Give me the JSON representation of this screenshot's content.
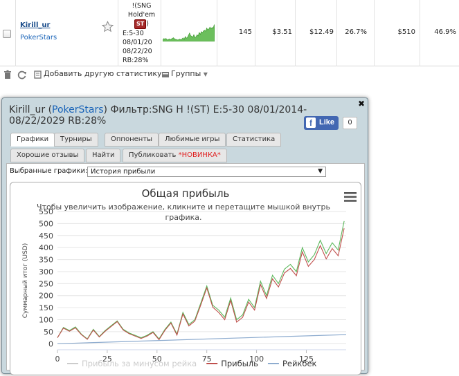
{
  "row": {
    "player": "Kirill_ur",
    "site": "PokerStars",
    "filter_lines": [
      "!(SNG",
      "Hold'em"
    ],
    "filter_badge": "ST",
    "filter_after_badge": ")",
    "filter_rest": [
      "E:5-30",
      "08/01/20",
      "08/22/20",
      "RB:28%"
    ],
    "games": "145",
    "avg_stake": "$3.51",
    "avg_profit": "$12.49",
    "avg_roi": "26.7%",
    "total_profit": "$510",
    "abi": "46.9%"
  },
  "toolbar": {
    "add_stats": "Добавить другую статистику",
    "groups": "Группы"
  },
  "popup": {
    "title_name": "Kirill_ur (",
    "title_site": "PokerStars",
    "title_rest": ") Фильтр:SNG H !(ST) E:5-30 08/01/2014-08/22/2029 RB:28%",
    "fb_like": "Like",
    "fb_count": "0",
    "tabs_row1": [
      "Графики",
      "Турниры",
      "Оппоненты",
      "Любимые игры",
      "Статистика"
    ],
    "tabs_row2": [
      "Хорошие отзывы",
      "Найти",
      "Публиковать "
    ],
    "tab_new": "*НОВИНКА*",
    "selector_label": "Выбранные графики:",
    "selector_value": "История прибыли"
  },
  "chart_data": {
    "type": "line",
    "title": "Общая прибыль",
    "subtitle": "Чтобы увеличить изображение, кликните и перетащите мышкой внутрь графика.",
    "ylabel": "Суммарный итог (USD)",
    "xlabel": "",
    "ylim": [
      -25,
      550
    ],
    "yticks": [
      0,
      50,
      100,
      150,
      200,
      250,
      300,
      350,
      400,
      450,
      500,
      550
    ],
    "xlim": [
      0,
      145
    ],
    "xticks": [
      0,
      25,
      50,
      75,
      100,
      125
    ],
    "colors": {
      "green": "#5cb85c",
      "red": "#c0504d",
      "blue": "#8eaccf"
    },
    "series": [
      {
        "name": "",
        "color": "#5cb85c",
        "x": [
          0,
          3,
          6,
          9,
          12,
          15,
          18,
          21,
          24,
          27,
          30,
          33,
          36,
          39,
          42,
          45,
          48,
          51,
          54,
          57,
          60,
          63,
          66,
          69,
          72,
          75,
          78,
          81,
          84,
          87,
          90,
          93,
          96,
          99,
          102,
          105,
          108,
          111,
          114,
          117,
          120,
          123,
          126,
          129,
          132,
          135,
          138,
          141,
          144
        ],
        "y": [
          25,
          68,
          55,
          70,
          40,
          20,
          60,
          30,
          55,
          75,
          95,
          60,
          45,
          35,
          25,
          35,
          50,
          20,
          60,
          90,
          40,
          130,
          80,
          100,
          170,
          240,
          160,
          140,
          110,
          190,
          100,
          120,
          185,
          150,
          260,
          200,
          285,
          250,
          310,
          330,
          300,
          400,
          340,
          370,
          430,
          375,
          420,
          390,
          510
        ]
      },
      {
        "name": "Прибыль",
        "color": "#c0504d",
        "x": [
          0,
          3,
          6,
          9,
          12,
          15,
          18,
          21,
          24,
          27,
          30,
          33,
          36,
          39,
          42,
          45,
          48,
          51,
          54,
          57,
          60,
          63,
          66,
          69,
          72,
          75,
          78,
          81,
          84,
          87,
          90,
          93,
          96,
          99,
          102,
          105,
          108,
          111,
          114,
          117,
          120,
          123,
          126,
          129,
          132,
          135,
          138,
          141,
          144
        ],
        "y": [
          25,
          65,
          52,
          66,
          38,
          18,
          57,
          28,
          52,
          72,
          92,
          57,
          42,
          32,
          22,
          32,
          47,
          17,
          56,
          86,
          36,
          124,
          74,
          94,
          162,
          232,
          152,
          130,
          100,
          180,
          90,
          110,
          173,
          140,
          246,
          188,
          270,
          236,
          294,
          313,
          283,
          382,
          322,
          350,
          408,
          353,
          396,
          366,
          480
        ]
      },
      {
        "name": "Рейкбек",
        "color": "#8eaccf",
        "x": [
          0,
          145
        ],
        "y": [
          0,
          38
        ]
      }
    ],
    "legend": [
      {
        "name": "Прибыль за минусом рейка",
        "color": "#5cb85c",
        "hidden": true
      },
      {
        "name": "Прибыль",
        "color": "#c0504d"
      },
      {
        "name": "Рейкбек",
        "color": "#8eaccf"
      }
    ],
    "grid": true
  }
}
